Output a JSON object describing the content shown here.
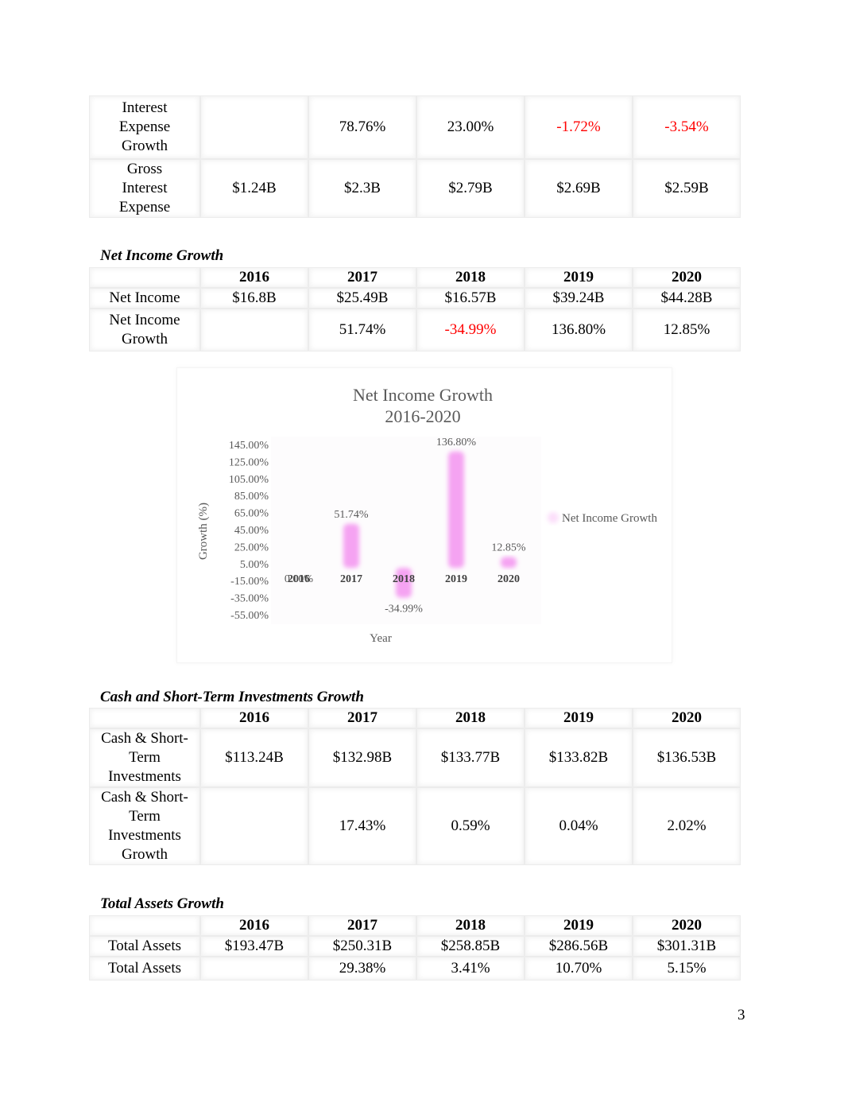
{
  "interest_table": {
    "rows": [
      {
        "label": "Interest Expense Growth",
        "cells": [
          "",
          "78.76%",
          "23.00%",
          "-1.72%",
          "-3.54%"
        ],
        "negative": [
          false,
          false,
          false,
          true,
          true
        ]
      },
      {
        "label": "Gross Interest Expense",
        "cells": [
          "$1.24B",
          "$2.3B",
          "$2.79B",
          "$2.69B",
          "$2.59B"
        ],
        "negative": [
          false,
          false,
          false,
          false,
          false
        ]
      }
    ]
  },
  "net_income_section": {
    "title": "Net Income Growth",
    "years": [
      "2016",
      "2017",
      "2018",
      "2019",
      "2020"
    ],
    "rows": [
      {
        "label": "Net Income",
        "cells": [
          "$16.8B",
          "$25.49B",
          "$16.57B",
          "$39.24B",
          "$44.28B"
        ],
        "negative": [
          false,
          false,
          false,
          false,
          false
        ]
      },
      {
        "label": "Net Income Growth",
        "cells": [
          "",
          "51.74%",
          "-34.99%",
          "136.80%",
          "12.85%"
        ],
        "negative": [
          false,
          false,
          true,
          false,
          false
        ]
      }
    ]
  },
  "chart_data": {
    "type": "bar",
    "title": "Net Income Growth 2016-2020",
    "title_lines": [
      "Net Income Growth",
      "2016-2020"
    ],
    "xlabel": "Year",
    "ylabel": "Growth (%)",
    "categories": [
      "2016",
      "2017",
      "2018",
      "2019",
      "2020"
    ],
    "series": [
      {
        "name": "Net Income Growth",
        "values": [
          0.0,
          51.74,
          -34.99,
          136.8,
          12.85
        ],
        "color": "#f5a3f2"
      }
    ],
    "data_labels": [
      "0.00%",
      "51.74%",
      "-34.99%",
      "136.80%",
      "12.85%"
    ],
    "yticks": [
      145,
      125,
      105,
      85,
      65,
      45,
      25,
      5,
      -15,
      -35,
      -55
    ],
    "ytick_labels": [
      "145.00%",
      "125.00%",
      "105.00%",
      "85.00%",
      "65.00%",
      "45.00%",
      "25.00%",
      "5.00%",
      "-15.00%",
      "-35.00%",
      "-55.00%"
    ],
    "ylim": [
      -55,
      145
    ],
    "grid": false,
    "legend": "right"
  },
  "cash_section": {
    "title": "Cash and Short-Term Investments Growth",
    "years": [
      "2016",
      "2017",
      "2018",
      "2019",
      "2020"
    ],
    "rows": [
      {
        "label": "Cash & Short-Term Investments",
        "cells": [
          "$113.24B",
          "$132.98B",
          "$133.77B",
          "$133.82B",
          "$136.53B"
        ],
        "negative": [
          false,
          false,
          false,
          false,
          false
        ]
      },
      {
        "label": "Cash & Short-Term Investments Growth",
        "cells": [
          "",
          "17.43%",
          "0.59%",
          "0.04%",
          "2.02%"
        ],
        "negative": [
          false,
          false,
          false,
          false,
          false
        ]
      }
    ]
  },
  "assets_section": {
    "title": "Total Assets Growth",
    "years": [
      "2016",
      "2017",
      "2018",
      "2019",
      "2020"
    ],
    "rows": [
      {
        "label": "Total Assets",
        "cells": [
          "$193.47B",
          "$250.31B",
          "$258.85B",
          "$286.56B",
          "$301.31B"
        ],
        "negative": [
          false,
          false,
          false,
          false,
          false
        ]
      },
      {
        "label": "Total Assets",
        "cells": [
          "",
          "29.38%",
          "3.41%",
          "10.70%",
          "5.15%"
        ],
        "negative": [
          false,
          false,
          false,
          false,
          false
        ]
      }
    ]
  },
  "page_number": "3",
  "colors": {
    "negative": "#ff0000",
    "bar": "#f5a3f2",
    "chart_text": "#595959"
  }
}
